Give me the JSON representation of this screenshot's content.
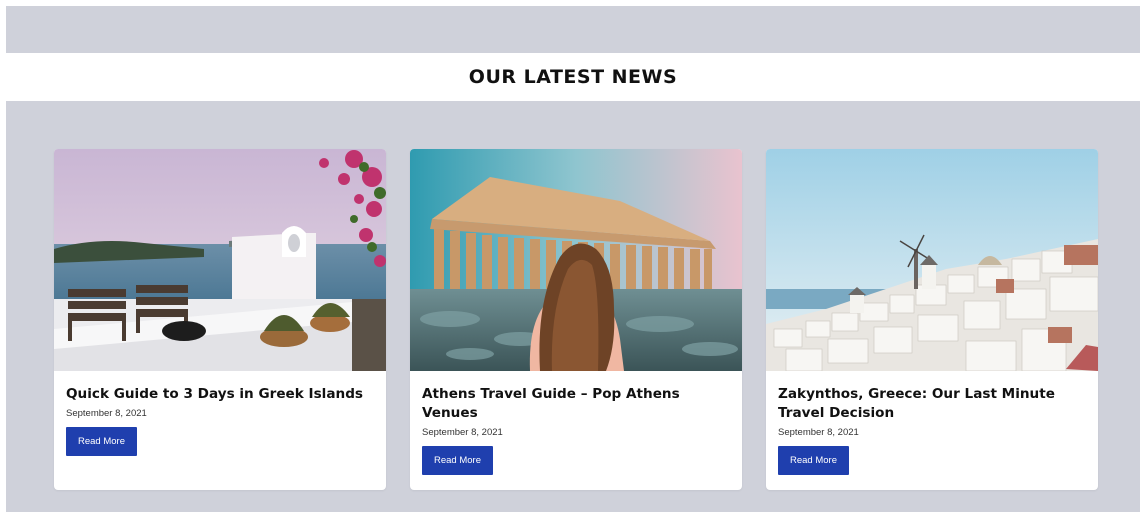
{
  "section": {
    "title": "OUR LATEST NEWS"
  },
  "posts": [
    {
      "title": "Quick Guide to 3 Days in Greek Islands",
      "date": "September 8, 2021",
      "button": "Read More"
    },
    {
      "title": "Athens Travel Guide – Pop Athens Venues",
      "date": "September 8, 2021",
      "button": "Read More"
    },
    {
      "title": "Zakynthos, Greece: Our Last Minute Travel Decision",
      "date": "September 8, 2021",
      "button": "Read More"
    }
  ],
  "colors": {
    "background_band": "#cfd1da",
    "button": "#1f3fae",
    "card": "#ffffff"
  }
}
